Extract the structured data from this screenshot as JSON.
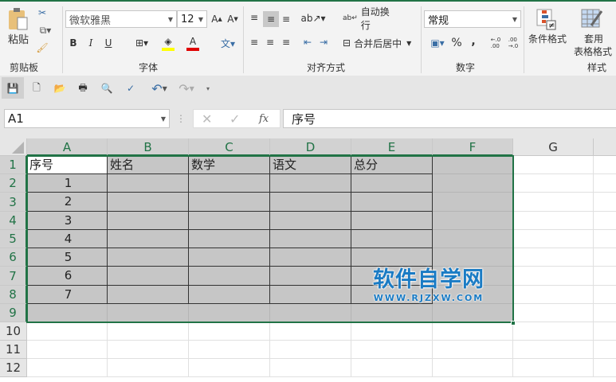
{
  "ribbon": {
    "clipboard": {
      "paste": "粘贴",
      "label": "剪贴板"
    },
    "font": {
      "name": "微软雅黑",
      "size": "12",
      "bold": "B",
      "italic": "I",
      "underline": "U",
      "color_glyph": "A",
      "label": "字体",
      "fill_color": "#ffff00",
      "font_color": "#e00000"
    },
    "alignment": {
      "wrap": "自动换行",
      "merge": "合并后居中",
      "label": "对齐方式"
    },
    "number": {
      "format": "常规",
      "percent": "%",
      "comma": ",",
      "label": "数字"
    },
    "styles": {
      "conditional": "条件格式",
      "table_line1": "套用",
      "table_line2": "表格格式",
      "label": "样式"
    }
  },
  "formula_bar": {
    "name_box": "A1",
    "fx": "fx",
    "content": "序号"
  },
  "sheet": {
    "columns": [
      "A",
      "B",
      "C",
      "D",
      "E",
      "F",
      "G"
    ],
    "rows": [
      "1",
      "2",
      "3",
      "4",
      "5",
      "6",
      "7",
      "8",
      "9",
      "10",
      "11",
      "12"
    ],
    "cells": [
      [
        "序号",
        "姓名",
        "数学",
        "语文",
        "总分"
      ],
      [
        "1"
      ],
      [
        "2"
      ],
      [
        "3"
      ],
      [
        "4"
      ],
      [
        "5"
      ],
      [
        "6"
      ],
      [
        "7"
      ]
    ],
    "active_cell": "A1",
    "selection": "A1:F9"
  },
  "watermark": {
    "title": "软件自学网",
    "url": "WWW.RJZXW.COM",
    "color": "#1a7bc4"
  },
  "accent": "#217346"
}
